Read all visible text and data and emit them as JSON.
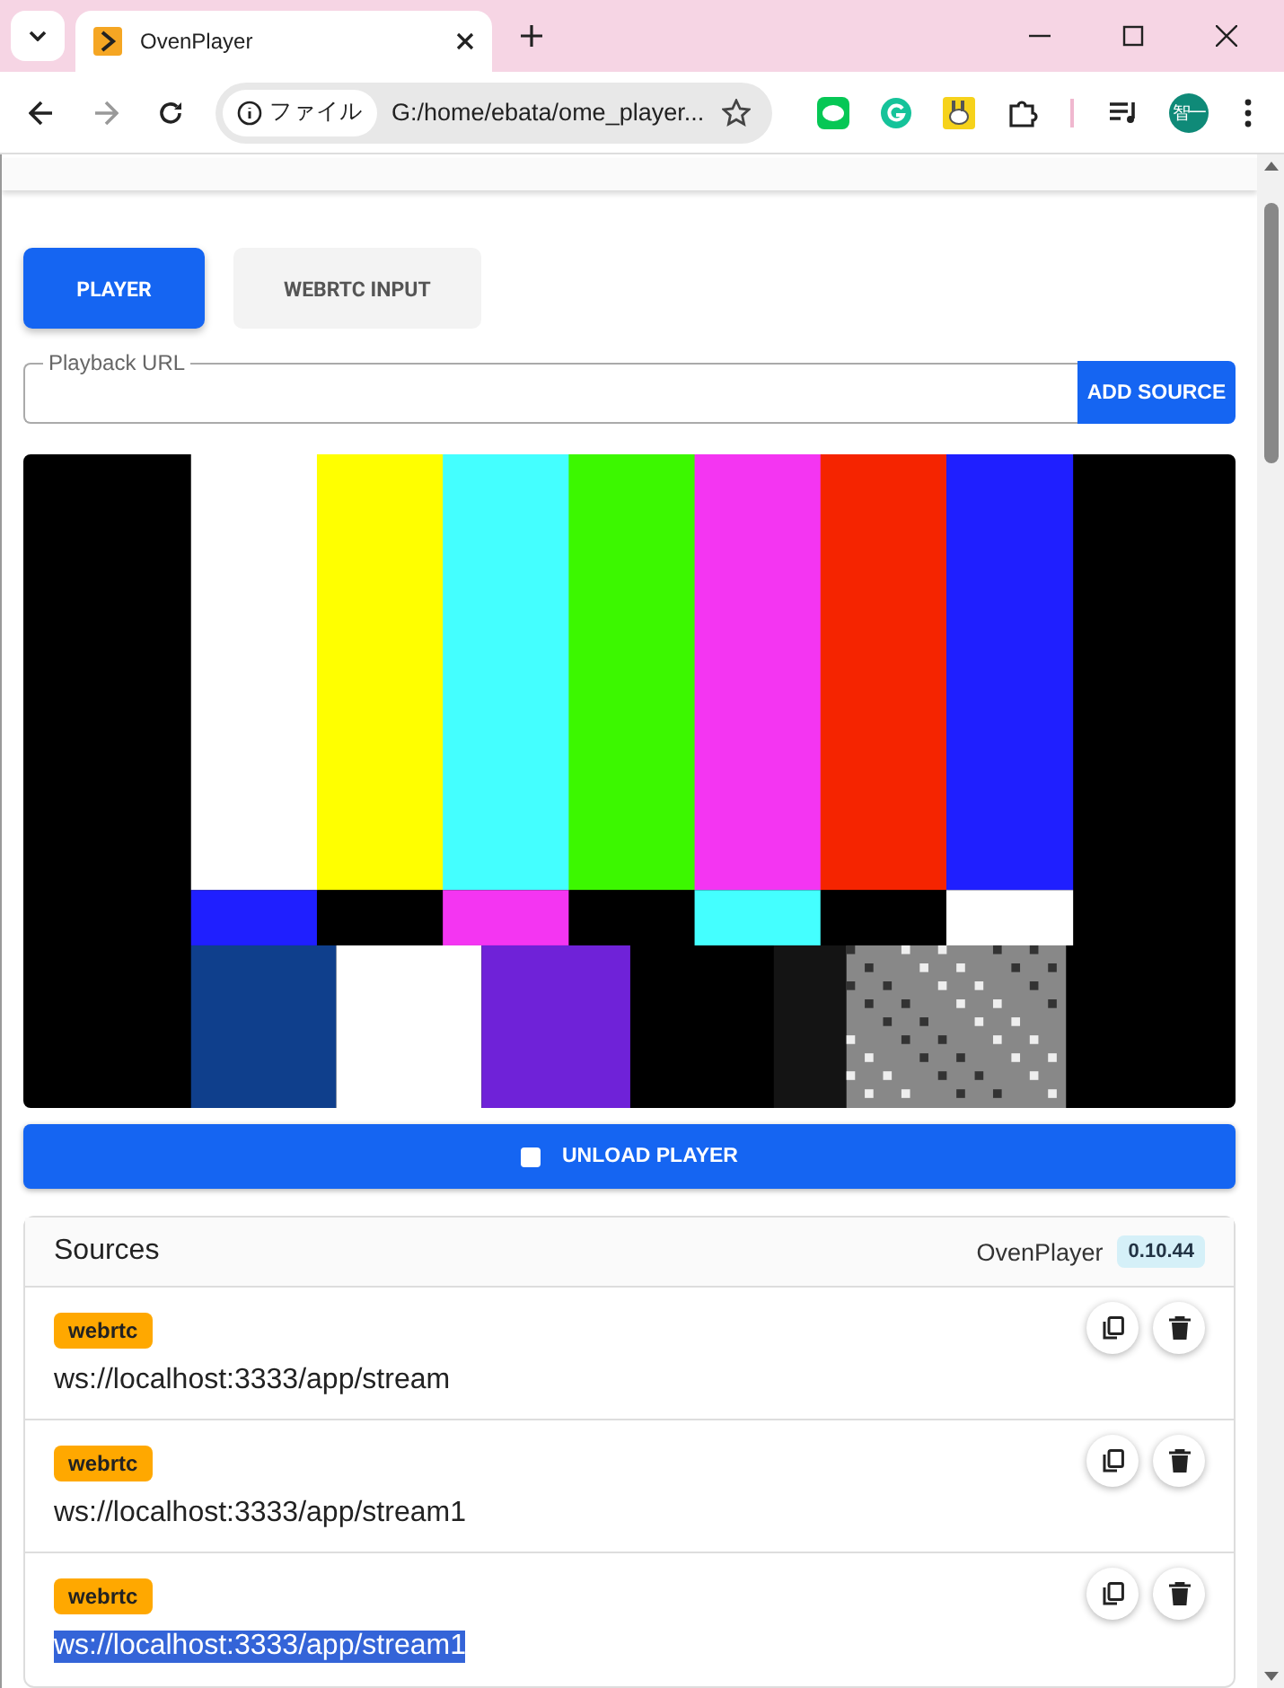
{
  "browser": {
    "tab": {
      "title": "OvenPlayer"
    },
    "address": {
      "security_label": "ファイル",
      "url": "G:/home/ebata/ome_player..."
    },
    "profile": {
      "initials": "智一"
    }
  },
  "tabs": [
    {
      "label": "PLAYER",
      "selected": true
    },
    {
      "label": "WEBRTC INPUT",
      "selected": false
    }
  ],
  "playback_url": {
    "label": "Playback URL",
    "button": "ADD SOURCE"
  },
  "unload_button": "UNLOAD PLAYER",
  "sources": {
    "title": "Sources",
    "player_name": "OvenPlayer",
    "version": "0.10.44",
    "items": [
      {
        "type": "webrtc",
        "url": "ws://localhost:3333/app/stream",
        "selected": false
      },
      {
        "type": "webrtc",
        "url": "ws://localhost:3333/app/stream1",
        "selected": false
      },
      {
        "type": "webrtc",
        "url": "ws://localhost:3333/app/stream1",
        "selected": true
      }
    ]
  }
}
